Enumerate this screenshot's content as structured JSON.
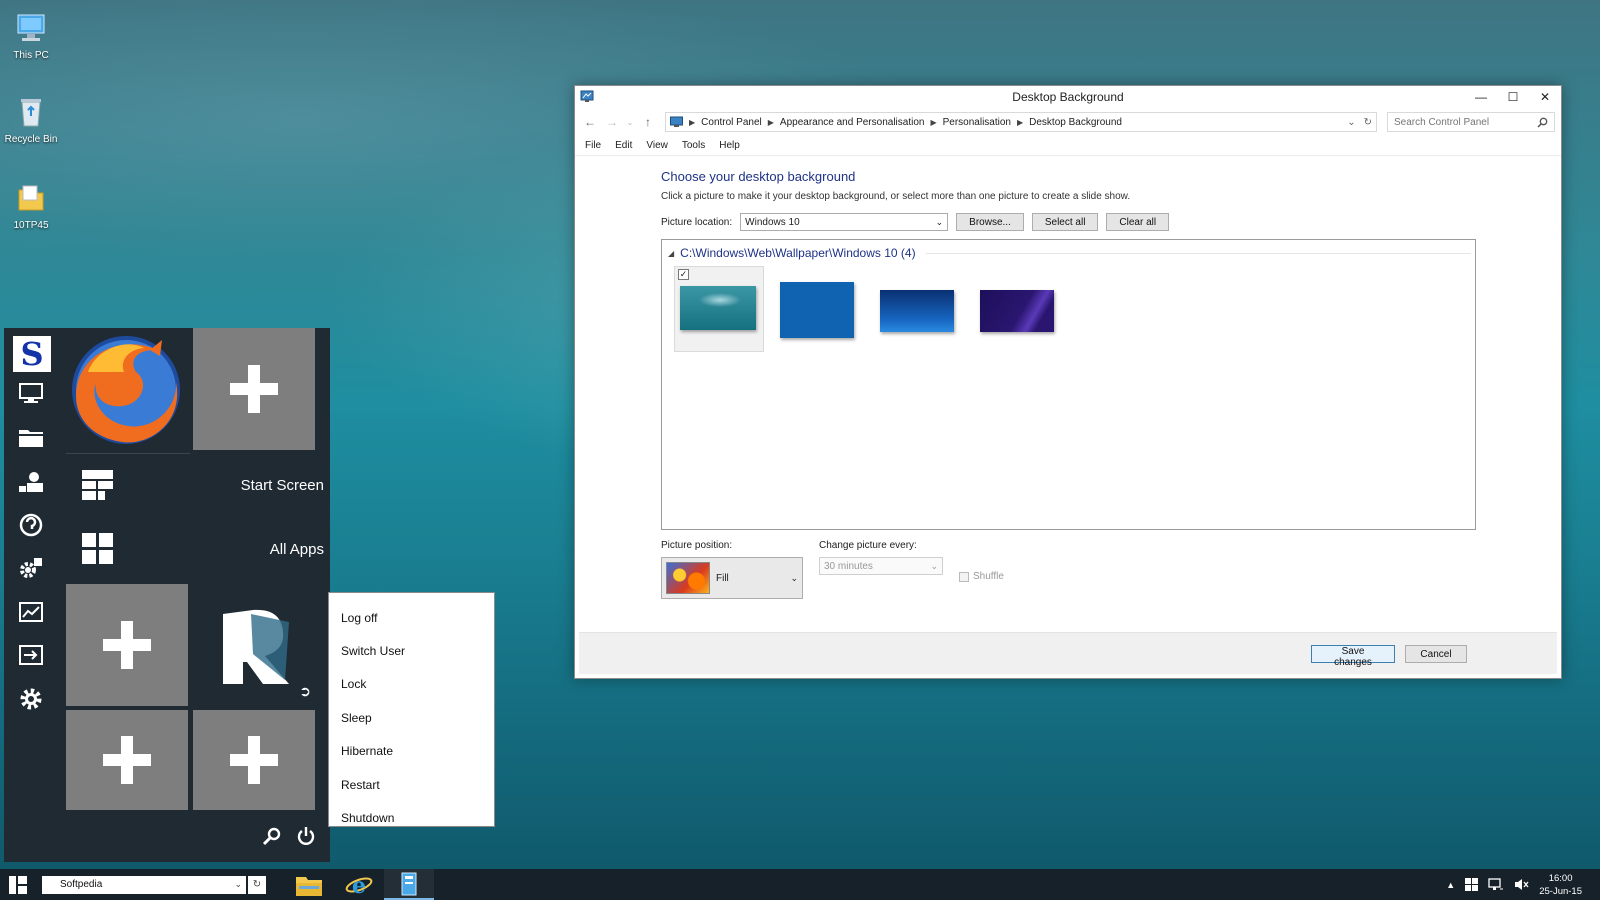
{
  "desktop": {
    "icons": [
      {
        "label": "This PC",
        "icon": "computer-icon"
      },
      {
        "label": "Recycle Bin",
        "icon": "recycle-bin-icon"
      },
      {
        "label": "10TP45",
        "icon": "folder-icon"
      }
    ]
  },
  "window": {
    "title": "Desktop Background",
    "controls": {
      "minimize": "—",
      "maximize": "☐",
      "close": "✕"
    },
    "breadcrumb": [
      "Control Panel",
      "Appearance and Personalisation",
      "Personalisation",
      "Desktop Background"
    ],
    "search_placeholder": "Search Control Panel",
    "menu": [
      "File",
      "Edit",
      "View",
      "Tools",
      "Help"
    ],
    "heading": "Choose your desktop background",
    "subtext": "Click a picture to make it your desktop background, or select more than one picture to create a slide show.",
    "picture_location_label": "Picture location:",
    "picture_location_value": "Windows 10",
    "buttons": {
      "browse": "Browse...",
      "select_all": "Select all",
      "clear_all": "Clear all"
    },
    "group_label": "C:\\Windows\\Web\\Wallpaper\\Windows 10 (4)",
    "thumbnails": [
      {
        "name": "underwater",
        "selected": true,
        "colors": [
          "#2c8a98",
          "#1a6c7c"
        ]
      },
      {
        "name": "blue",
        "selected": false,
        "colors": [
          "#0f63b0",
          "#0f63b0"
        ]
      },
      {
        "name": "dark-blue",
        "selected": false,
        "colors": [
          "#1766c0",
          "#0a2f73"
        ]
      },
      {
        "name": "purple",
        "selected": false,
        "colors": [
          "#2a1670",
          "#3a2a96"
        ]
      }
    ],
    "picture_position_label": "Picture position:",
    "picture_position_value": "Fill",
    "change_every_label": "Change picture every:",
    "change_every_value": "30 minutes",
    "shuffle_label": "Shuffle",
    "save_label": "Save changes",
    "cancel_label": "Cancel"
  },
  "start_menu": {
    "rail": [
      "softpedia-logo-icon",
      "monitor-icon",
      "folder-icon",
      "users-icon",
      "help-icon",
      "settings-cog-icon",
      "chart-icon",
      "switch-icon",
      "gear-icon"
    ],
    "start_screen_label": "Start Screen",
    "all_apps_label": "All Apps"
  },
  "power_menu": {
    "items": [
      "Log off",
      "Switch User",
      "Lock",
      "Sleep",
      "Hibernate",
      "Restart",
      "Shutdown"
    ]
  },
  "taskbar": {
    "search_value": "Softpedia",
    "time": "16:00",
    "date": "25-Jun-15"
  },
  "colors": {
    "accent_heading": "#1e3287",
    "start_bg": "#1f2a33",
    "taskbar_bg": "#17212a",
    "tile_gray": "#7e7e7e"
  }
}
